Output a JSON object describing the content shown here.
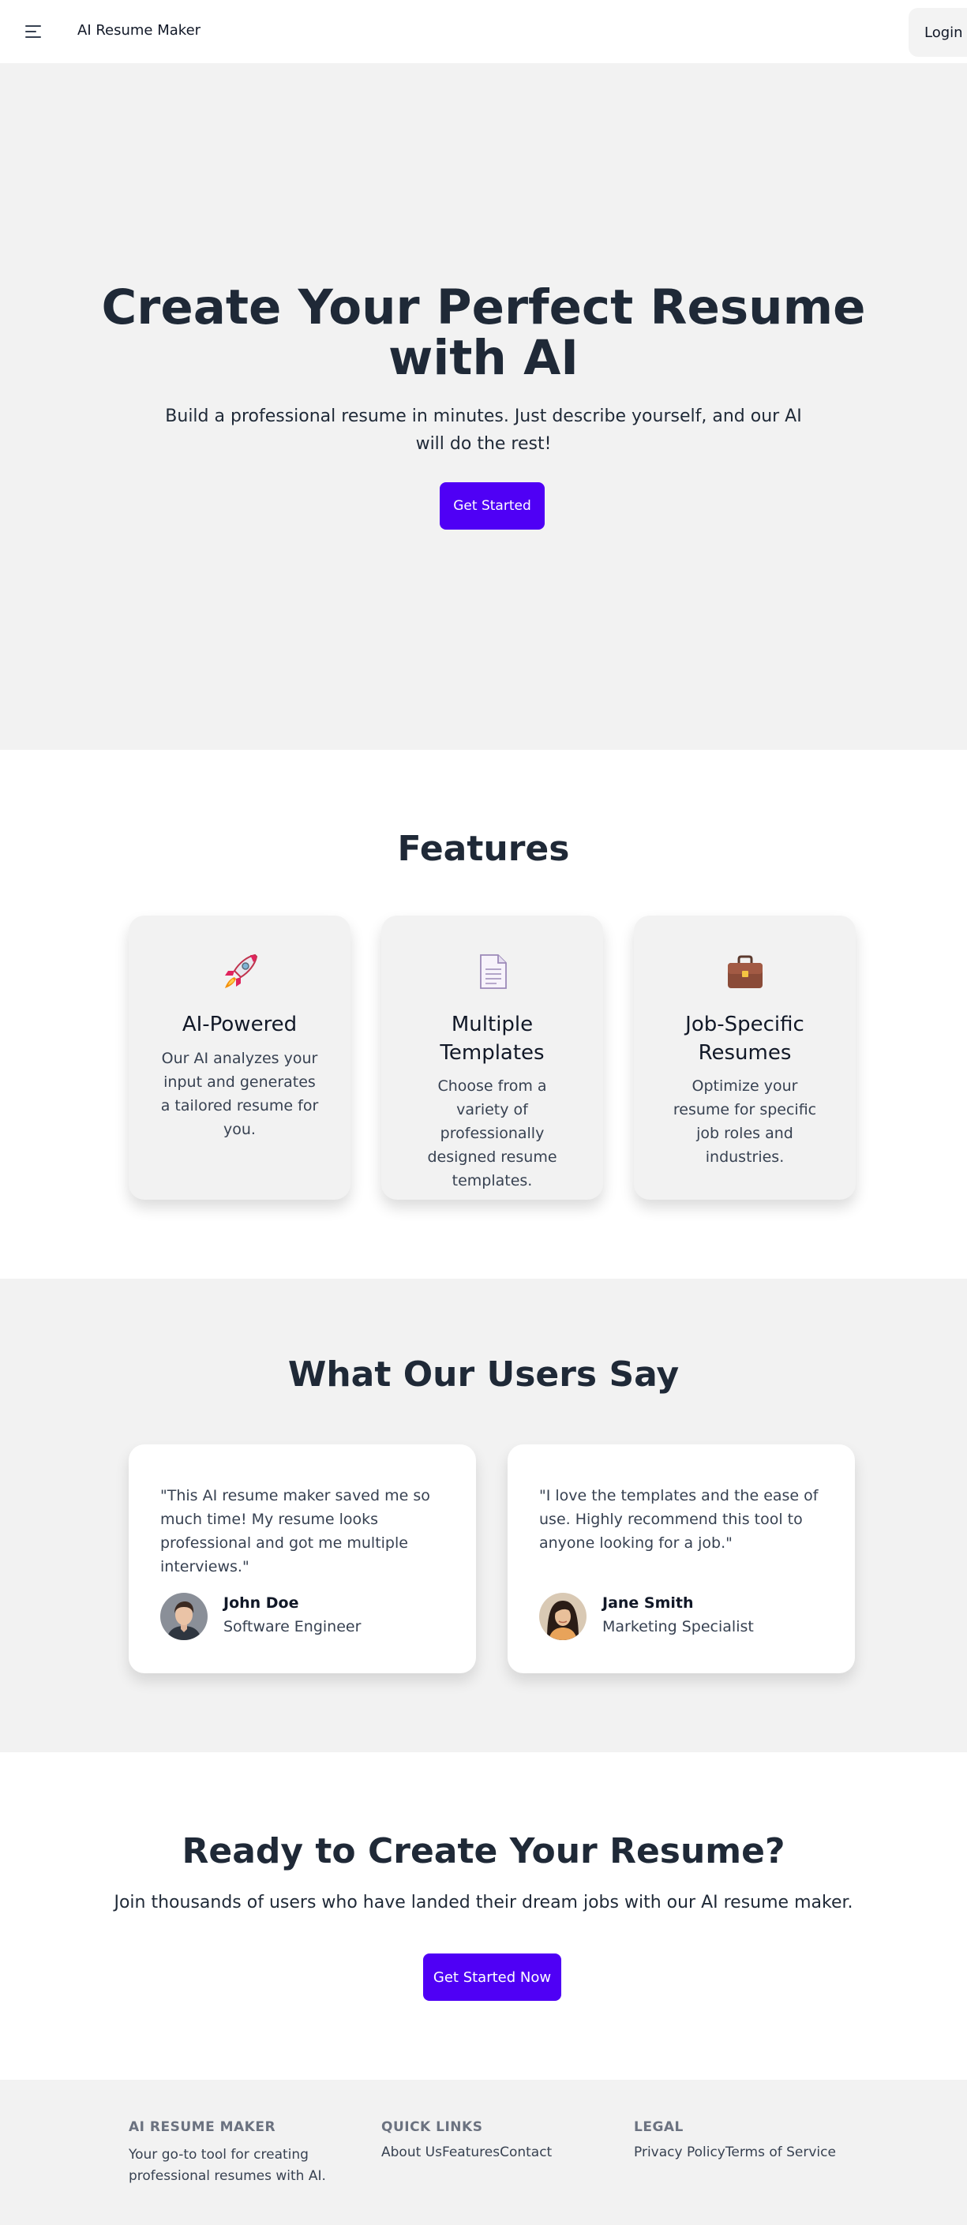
{
  "nav": {
    "brand": "AI Resume Maker",
    "login_label": "Login"
  },
  "hero": {
    "title_line1": "Create Your Perfect Resume",
    "title_line2": "with AI",
    "subtitle": "Build a professional resume in minutes. Just describe yourself, and our AI will do the rest!",
    "cta_label": "Get Started"
  },
  "features": {
    "title": "Features",
    "items": [
      {
        "icon": "rocket-icon",
        "title": "AI-Powered",
        "description": "Our AI analyzes your input and generates a tailored resume for you."
      },
      {
        "icon": "document-icon",
        "title": "Multiple Templates",
        "description": "Choose from a variety of professionally designed resume templates."
      },
      {
        "icon": "briefcase-icon",
        "title": "Job-Specific Resumes",
        "description": "Optimize your resume for specific job roles and industries."
      }
    ]
  },
  "testimonials": {
    "title": "What Our Users Say",
    "items": [
      {
        "quote": "\"This AI resume maker saved me so much time! My resume looks professional and got me multiple interviews.\"",
        "name": "John Doe",
        "role": "Software Engineer"
      },
      {
        "quote": "\"I love the templates and the ease of use. Highly recommend this tool to anyone looking for a job.\"",
        "name": "Jane Smith",
        "role": "Marketing Specialist"
      }
    ]
  },
  "cta": {
    "title": "Ready to Create Your Resume?",
    "subtitle": "Join thousands of users who have landed their dream jobs with our AI resume maker.",
    "button_label": "Get Started Now"
  },
  "footer": {
    "about": {
      "heading": "AI RESUME MAKER",
      "text": "Your go-to tool for creating professional resumes with AI."
    },
    "quick_links": {
      "heading": "QUICK LINKS",
      "links": [
        "About Us",
        "Features",
        "Contact"
      ]
    },
    "legal": {
      "heading": "LEGAL",
      "links": [
        "Privacy Policy",
        "Terms of Service"
      ]
    }
  },
  "colors": {
    "primary": "#4f00f5",
    "text_dark": "#1f2937",
    "section_gray": "#f2f2f2"
  }
}
